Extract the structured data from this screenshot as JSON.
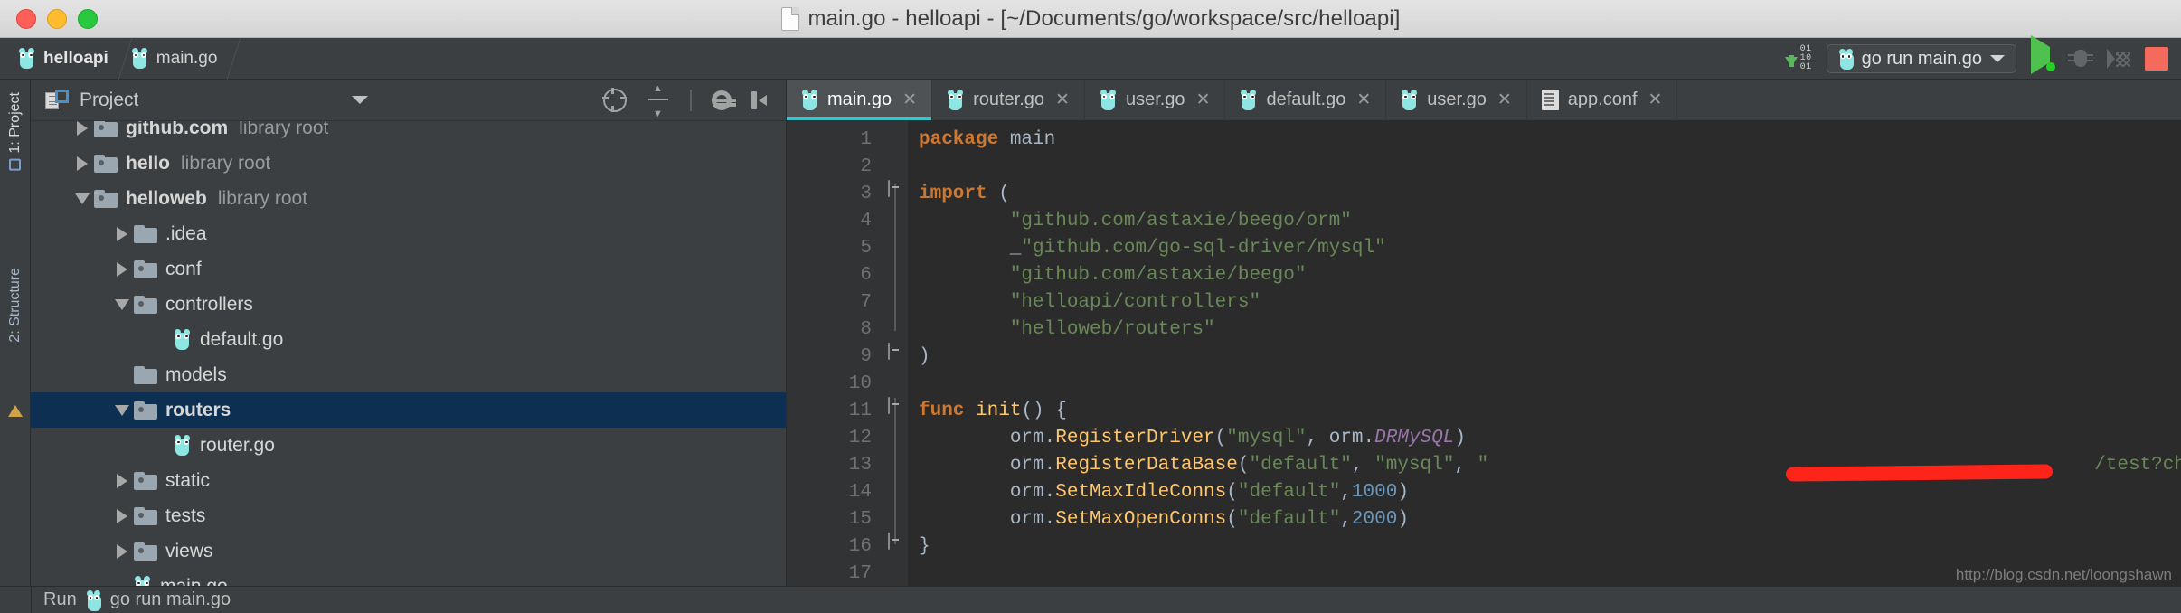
{
  "window": {
    "title": "main.go - helloapi - [~/Documents/go/workspace/src/helloapi]",
    "traffic_colors": {
      "close": "#ff5f57",
      "minimize": "#febc2e",
      "zoom": "#28c840"
    }
  },
  "navbar": {
    "crumbs": [
      {
        "label": "helloapi",
        "icon": "gopher-icon"
      },
      {
        "label": "main.go",
        "icon": "gopher-icon"
      }
    ],
    "binary_digits": [
      "01",
      "10",
      "01"
    ],
    "run_config": {
      "label": "go run main.go",
      "icon": "gopher-icon"
    },
    "buttons": [
      "run-button",
      "debug-button",
      "coverage-button",
      "stop-button"
    ],
    "accent_run": "#4fc14f",
    "accent_stop": "#f46b5d"
  },
  "tool_strip": {
    "project_tab": "1: Project",
    "structure_tab": "2: Structure"
  },
  "project_panel": {
    "title": "Project",
    "icons": [
      "locate-target-icon",
      "collapse-all-icon",
      "settings-gear-icon",
      "hide-panel-icon"
    ],
    "tree": [
      {
        "indent": 1,
        "twist": "right",
        "icon": "folder",
        "name": "github.com",
        "meta": "library root",
        "bold": true,
        "selected": false,
        "partial": true
      },
      {
        "indent": 1,
        "twist": "right",
        "icon": "folder",
        "name": "hello",
        "meta": "library root",
        "bold": true,
        "selected": false
      },
      {
        "indent": 1,
        "twist": "down",
        "icon": "folder",
        "name": "helloweb",
        "meta": "library root",
        "bold": true,
        "selected": false
      },
      {
        "indent": 2,
        "twist": "right",
        "icon": "folder-plain",
        "name": ".idea",
        "meta": "",
        "bold": false,
        "selected": false
      },
      {
        "indent": 2,
        "twist": "right",
        "icon": "folder",
        "name": "conf",
        "meta": "",
        "bold": false,
        "selected": false
      },
      {
        "indent": 2,
        "twist": "down",
        "icon": "folder",
        "name": "controllers",
        "meta": "",
        "bold": false,
        "selected": false
      },
      {
        "indent": 3,
        "twist": "none",
        "icon": "gopher",
        "name": "default.go",
        "meta": "",
        "bold": false,
        "selected": false
      },
      {
        "indent": 2,
        "twist": "none",
        "icon": "folder-blue",
        "name": "models",
        "meta": "",
        "bold": false,
        "selected": false
      },
      {
        "indent": 2,
        "twist": "down",
        "icon": "folder",
        "name": "routers",
        "meta": "",
        "bold": true,
        "selected": true
      },
      {
        "indent": 3,
        "twist": "none",
        "icon": "gopher",
        "name": "router.go",
        "meta": "",
        "bold": false,
        "selected": false
      },
      {
        "indent": 2,
        "twist": "right",
        "icon": "folder",
        "name": "static",
        "meta": "",
        "bold": false,
        "selected": false
      },
      {
        "indent": 2,
        "twist": "right",
        "icon": "folder",
        "name": "tests",
        "meta": "",
        "bold": false,
        "selected": false
      },
      {
        "indent": 2,
        "twist": "right",
        "icon": "folder",
        "name": "views",
        "meta": "",
        "bold": false,
        "selected": false
      },
      {
        "indent": 2,
        "twist": "none",
        "icon": "gopher",
        "name": "main.go",
        "meta": "",
        "bold": false,
        "selected": false
      }
    ]
  },
  "editor": {
    "tabs": [
      {
        "label": "main.go",
        "icon": "gopher-icon",
        "active": true
      },
      {
        "label": "router.go",
        "icon": "gopher-icon",
        "active": false
      },
      {
        "label": "user.go",
        "icon": "gopher-icon",
        "active": false
      },
      {
        "label": "default.go",
        "icon": "gopher-icon",
        "active": false
      },
      {
        "label": "user.go",
        "icon": "gopher-icon",
        "active": false
      },
      {
        "label": "app.conf",
        "icon": "config-file-icon",
        "active": false
      }
    ],
    "active_tab_underline": "#3fc1c9",
    "close_glyph": "✕",
    "line_numbers": [
      1,
      2,
      3,
      4,
      5,
      6,
      7,
      8,
      9,
      10,
      11,
      12,
      13,
      14,
      15,
      16,
      17
    ],
    "lines": [
      {
        "n": 1,
        "tokens": [
          {
            "t": "package ",
            "c": "kw"
          },
          {
            "t": "main",
            "c": "id"
          }
        ]
      },
      {
        "n": 2,
        "tokens": []
      },
      {
        "n": 3,
        "tokens": [
          {
            "t": "import ",
            "c": "kw"
          },
          {
            "t": "(",
            "c": "pnc"
          }
        ],
        "fold": "start"
      },
      {
        "n": 4,
        "tokens": [
          {
            "t": "        \"github.com/astaxie/beego/orm\"",
            "c": "str"
          }
        ]
      },
      {
        "n": 5,
        "tokens": [
          {
            "t": "        _",
            "c": "id"
          },
          {
            "t": "\"github.com/go-sql-driver/mysql\"",
            "c": "str"
          }
        ]
      },
      {
        "n": 6,
        "tokens": [
          {
            "t": "        \"github.com/astaxie/beego\"",
            "c": "str"
          }
        ]
      },
      {
        "n": 7,
        "tokens": [
          {
            "t": "        \"helloapi/controllers\"",
            "c": "str"
          }
        ]
      },
      {
        "n": 8,
        "tokens": [
          {
            "t": "        \"helloweb/routers\"",
            "c": "str"
          }
        ]
      },
      {
        "n": 9,
        "tokens": [
          {
            "t": ")",
            "c": "pnc"
          }
        ],
        "fold": "end"
      },
      {
        "n": 10,
        "tokens": []
      },
      {
        "n": 11,
        "tokens": [
          {
            "t": "func ",
            "c": "kw"
          },
          {
            "t": "init",
            "c": "fn"
          },
          {
            "t": "() {",
            "c": "pnc"
          }
        ],
        "fold": "start"
      },
      {
        "n": 12,
        "tokens": [
          {
            "t": "        orm.",
            "c": "id"
          },
          {
            "t": "RegisterDriver",
            "c": "fn"
          },
          {
            "t": "(",
            "c": "pnc"
          },
          {
            "t": "\"mysql\"",
            "c": "str"
          },
          {
            "t": ", ",
            "c": "pnc"
          },
          {
            "t": "orm.",
            "c": "id"
          },
          {
            "t": "DRMySQL",
            "c": "cnst"
          },
          {
            "t": ")",
            "c": "pnc"
          }
        ]
      },
      {
        "n": 13,
        "tokens": [
          {
            "t": "        orm.",
            "c": "id"
          },
          {
            "t": "RegisterDataBase",
            "c": "fn"
          },
          {
            "t": "(",
            "c": "pnc"
          },
          {
            "t": "\"default\"",
            "c": "str"
          },
          {
            "t": ", ",
            "c": "pnc"
          },
          {
            "t": "\"mysql\"",
            "c": "str"
          },
          {
            "t": ", ",
            "c": "pnc"
          },
          {
            "t": "\"",
            "c": "str"
          }
        ]
      },
      {
        "n": 14,
        "tokens": [
          {
            "t": "        orm.",
            "c": "id"
          },
          {
            "t": "SetMaxIdleConns",
            "c": "fn"
          },
          {
            "t": "(",
            "c": "pnc"
          },
          {
            "t": "\"default\"",
            "c": "str"
          },
          {
            "t": ",",
            "c": "pnc"
          },
          {
            "t": "1000",
            "c": "num"
          },
          {
            "t": ")",
            "c": "pnc"
          }
        ]
      },
      {
        "n": 15,
        "tokens": [
          {
            "t": "        orm.",
            "c": "id"
          },
          {
            "t": "SetMaxOpenConns",
            "c": "fn"
          },
          {
            "t": "(",
            "c": "pnc"
          },
          {
            "t": "\"default\"",
            "c": "str"
          },
          {
            "t": ",",
            "c": "pnc"
          },
          {
            "t": "2000",
            "c": "num"
          },
          {
            "t": ")",
            "c": "pnc"
          }
        ]
      },
      {
        "n": 16,
        "tokens": [
          {
            "t": "}",
            "c": "pnc"
          }
        ],
        "fold": "end"
      },
      {
        "n": 17,
        "tokens": []
      }
    ],
    "line13_tail": "/test?char",
    "redactions": [
      {
        "id": "red1",
        "color": "#ff2419",
        "covers": "line-8-underline-annotation"
      },
      {
        "id": "red2",
        "color": "#ff2419",
        "covers": "line-13-connection-string"
      }
    ]
  },
  "run_bar": {
    "label": "Run",
    "config": "go run main.go",
    "icon": "gopher-icon"
  },
  "watermark": "http://blog.csdn.net/loongshawn"
}
